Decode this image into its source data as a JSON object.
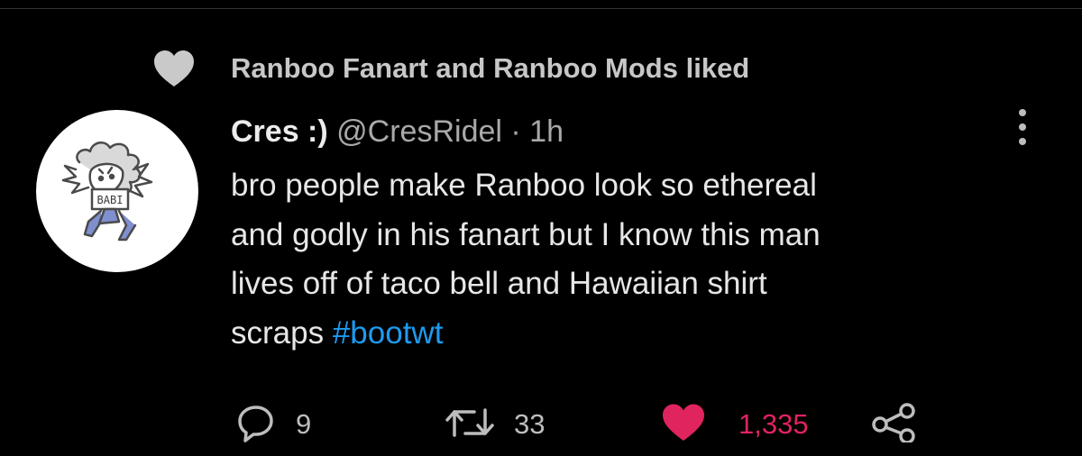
{
  "social_context": {
    "icon": "heart-icon",
    "text": "Ranboo Fanart and Ranboo Mods liked",
    "color": "#c7c7c7"
  },
  "tweet": {
    "author": {
      "display_name": "Cres :)",
      "handle": "@CresRidel",
      "avatar_label": "BABI"
    },
    "separator": "·",
    "time": "1h",
    "text_lines": [
      "bro people make Ranboo look so ethereal",
      "and godly in his fanart but I know this man",
      "lives off of taco bell and Hawaiian shirt",
      "scraps"
    ],
    "hashtag": "#bootwt",
    "hashtag_color": "#1d9bf0"
  },
  "actions": {
    "reply": {
      "icon": "reply-icon",
      "count": "9"
    },
    "retweet": {
      "icon": "retweet-icon",
      "count": "33"
    },
    "like": {
      "icon": "heart-filled-icon",
      "count": "1,335",
      "color": "#e0245e"
    },
    "share": {
      "icon": "share-icon"
    },
    "more": {
      "icon": "more-vertical-icon"
    }
  },
  "colors": {
    "background": "#000000",
    "text": "#e7e7e7",
    "muted": "#a9a9a9"
  }
}
